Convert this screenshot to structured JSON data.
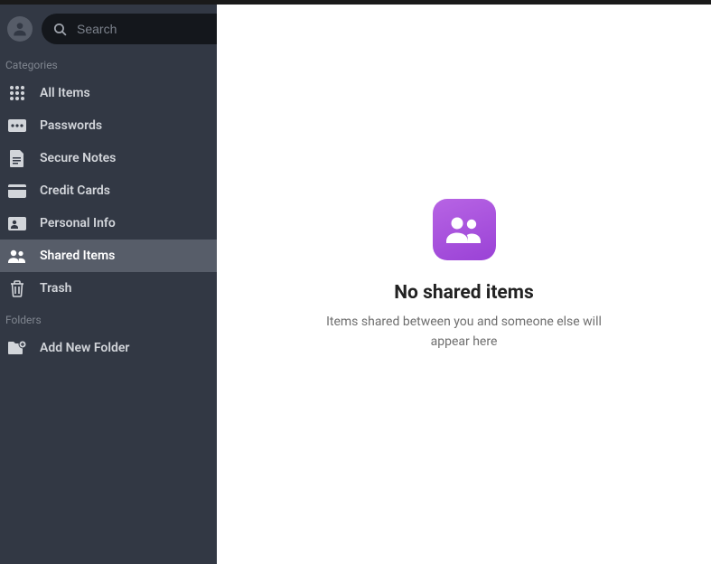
{
  "search": {
    "placeholder": "Search",
    "value": ""
  },
  "sections": {
    "categories_label": "Categories",
    "folders_label": "Folders"
  },
  "categories": {
    "0": {
      "label": "All Items"
    },
    "1": {
      "label": "Passwords"
    },
    "2": {
      "label": "Secure Notes"
    },
    "3": {
      "label": "Credit Cards"
    },
    "4": {
      "label": "Personal Info"
    },
    "5": {
      "label": "Shared Items"
    },
    "6": {
      "label": "Trash"
    }
  },
  "active_category": "Shared Items",
  "folders": {
    "add_new_label": "Add New Folder"
  },
  "empty_state": {
    "title": "No shared items",
    "subtitle": "Items shared between you and someone else will appear here"
  }
}
